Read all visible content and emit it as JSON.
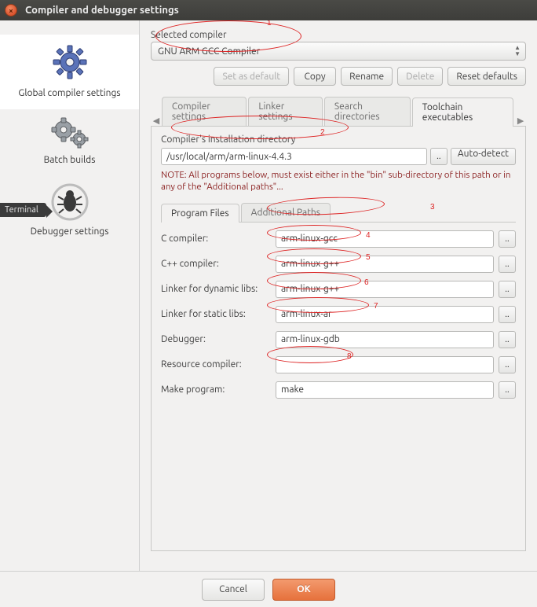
{
  "window": {
    "title": "Compiler and debugger settings",
    "ghost_title": "Global compiler settings"
  },
  "terminal_tag": "Terminal",
  "sidebar": {
    "items": [
      {
        "label": "Global compiler settings"
      },
      {
        "label": "Batch builds"
      },
      {
        "label": "Debugger settings"
      }
    ]
  },
  "selected_compiler": {
    "label": "Selected compiler",
    "value": "GNU ARM GCC Compiler"
  },
  "buttons": {
    "set_default": "Set as default",
    "copy": "Copy",
    "rename": "Rename",
    "delete": "Delete",
    "reset": "Reset defaults"
  },
  "main_tabs": {
    "compiler": "Compiler settings",
    "linker": "Linker settings",
    "search": "Search directories",
    "toolchain": "Toolchain executables"
  },
  "install_dir": {
    "label": "Compiler's installation directory",
    "value": "/usr/local/arm/arm-linux-4.4.3",
    "browse": "..",
    "auto": "Auto-detect",
    "note": "NOTE: All programs below, must exist either in the \"bin\" sub-directory of this path or in any of the \"Additional paths\"..."
  },
  "sub_tabs": {
    "program": "Program Files",
    "additional": "Additional Paths"
  },
  "fields": {
    "c_compiler": {
      "label": "C compiler:",
      "value": "arm-linux-gcc"
    },
    "cpp_compiler": {
      "label": "C++ compiler:",
      "value": "arm-linux-g++"
    },
    "linker_dyn": {
      "label": "Linker for dynamic libs:",
      "value": "arm-linux-g++"
    },
    "linker_static": {
      "label": "Linker for static libs:",
      "value": "arm-linux-ar"
    },
    "debugger": {
      "label": "Debugger:",
      "value": "arm-linux-gdb"
    },
    "rescomp": {
      "label": "Resource compiler:",
      "value": ""
    },
    "make": {
      "label": "Make program:",
      "value": "make"
    }
  },
  "footer": {
    "cancel": "Cancel",
    "ok": "OK"
  },
  "annotations": [
    "1",
    "2",
    "3",
    "4",
    "5",
    "6",
    "7",
    "8"
  ]
}
